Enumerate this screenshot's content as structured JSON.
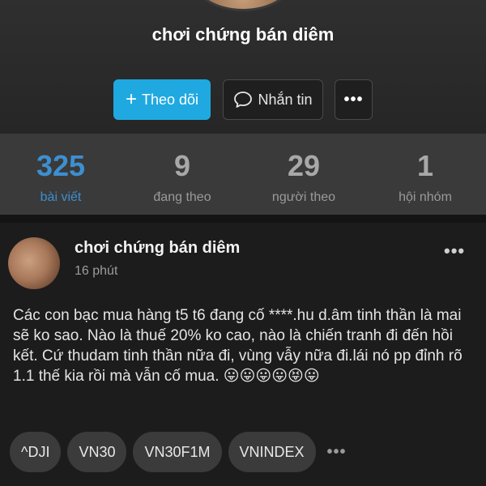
{
  "profile": {
    "name": "chơi chứng bán diêm",
    "follow_label": "Theo dõi",
    "follow_icon": "+",
    "message_label": "Nhắn tin",
    "more_label": "•••"
  },
  "stats": [
    {
      "value": "325",
      "label": "bài viết",
      "active": true
    },
    {
      "value": "9",
      "label": "đang theo",
      "active": false
    },
    {
      "value": "29",
      "label": "người theo",
      "active": false
    },
    {
      "value": "1",
      "label": "hội nhóm",
      "active": false
    }
  ],
  "post": {
    "author": "chơi chứng bán diêm",
    "time": "16 phút",
    "menu_label": "•••",
    "body": "Các con bạc mua hàng t5 t6 đang cố ****.hu d.âm tinh thần là mai sẽ ko sao. Nào là thuế 20% ko cao, nào là chiến tranh đi đến hồi kết. Cứ thudam tinh thần nữa đi, vùng vẫy nữa đi.lái nó pp đỉnh rõ 1.1 thế kia rồi mà vẫn cố mua. 😛😛😛😛😝😛",
    "tags": [
      "^DJI",
      "VN30",
      "VN30F1M",
      "VNINDEX"
    ],
    "tags_more": "•••"
  },
  "colors": {
    "accent": "#1fa9e0",
    "active_stat": "#3d8fd1"
  },
  "icons": {
    "message": "speech-bubble-icon",
    "more": "more-dots-icon"
  }
}
